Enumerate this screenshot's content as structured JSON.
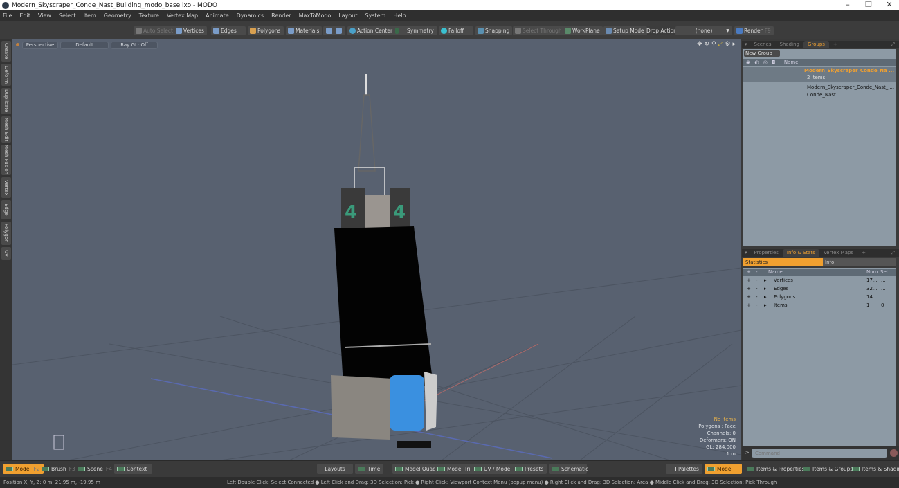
{
  "window": {
    "title": "Modern_Skyscraper_Conde_Nast_Building_modo_base.lxo - MODO",
    "minimize": "–",
    "maximize": "❐",
    "close": "✕"
  },
  "menu": [
    "File",
    "Edit",
    "View",
    "Select",
    "Item",
    "Geometry",
    "Texture",
    "Vertex Map",
    "Animate",
    "Dynamics",
    "Render",
    "MaxToModo",
    "Layout",
    "System",
    "Help"
  ],
  "toolbar": {
    "auto_select": "Auto Select",
    "vertices": "Vertices",
    "edges": "Edges",
    "polygons": "Polygons",
    "materials": "Materials",
    "action_center": "Action Center",
    "symmetry": "Symmetry",
    "falloff": "Falloff",
    "snapping": "Snapping",
    "select_through": "Select Through",
    "workplane": "WorkPlane",
    "setup_mode": "Setup Mode",
    "drop_action_label": "Drop Action",
    "drop_action_value": "(none)",
    "render": "Render",
    "render_key": "F9"
  },
  "left_tabs": [
    "Create",
    "Deform",
    "Duplicate",
    "Mesh Edit",
    "Mesh Fusion",
    "Vertex",
    "Edge",
    "Polygon",
    "UV"
  ],
  "viewport": {
    "view": "Perspective",
    "shading": "Default",
    "raygl": "Ray GL: Off",
    "stats": {
      "selection": "No Items",
      "mode": "Polygons : Face",
      "channels": "Channels: 0",
      "deformers": "Deformers: ON",
      "gl": "GL: 284,000",
      "scale": "1 m"
    },
    "accent": "#e8b24a"
  },
  "groups_panel": {
    "tabs": [
      "Scenes",
      "Shading",
      "Groups"
    ],
    "active_tab": "Groups",
    "new_group": "New Group",
    "column_name": "Name",
    "group_name": "Modern_Skyscraper_Conde_Na ...",
    "group_count": "2 Items",
    "children": [
      "Modern_Skyscraper_Conde_Nast_ ...",
      "Conde_Nast"
    ]
  },
  "info_panel": {
    "tabs": [
      "Properties",
      "Info & Stats",
      "Vertex Maps"
    ],
    "active_tab": "Info & Stats",
    "subtabs": [
      "Statistics",
      "Info"
    ],
    "columns": [
      "Name",
      "Num",
      "Sel"
    ],
    "rows": [
      {
        "name": "Vertices",
        "num": "17...",
        "sel": "..."
      },
      {
        "name": "Edges",
        "num": "32...",
        "sel": "..."
      },
      {
        "name": "Polygons",
        "num": "14...",
        "sel": "..."
      },
      {
        "name": "Items",
        "num": "1",
        "sel": "0"
      }
    ]
  },
  "command": {
    "placeholder": "Command"
  },
  "bottom": {
    "modes": [
      {
        "label": "Model",
        "key": "F2"
      },
      {
        "label": "Brush",
        "key": "F3"
      },
      {
        "label": "Scene",
        "key": "F4"
      },
      {
        "label": "Context",
        "key": ""
      }
    ],
    "layouts": "Layouts",
    "layout_buttons": [
      "Time",
      "Model Quad",
      "Model Tri",
      "UV / Model",
      "Presets",
      "Schematic"
    ],
    "palettes": "Palettes",
    "right_buttons": [
      "Model",
      "Items & Properties",
      "Items & Groups",
      "Items & Shading"
    ]
  },
  "status": {
    "position": "Position X, Y, Z:   0 m, 21.95 m, -19.95 m",
    "hints": "Left Double Click: Select Connected ● Left Click and Drag: 3D Selection: Pick ● Right Click: Viewport Context Menu (popup menu) ● Right Click and Drag: 3D Selection: Area ● Middle Click and Drag: 3D Selection: Pick Through"
  }
}
